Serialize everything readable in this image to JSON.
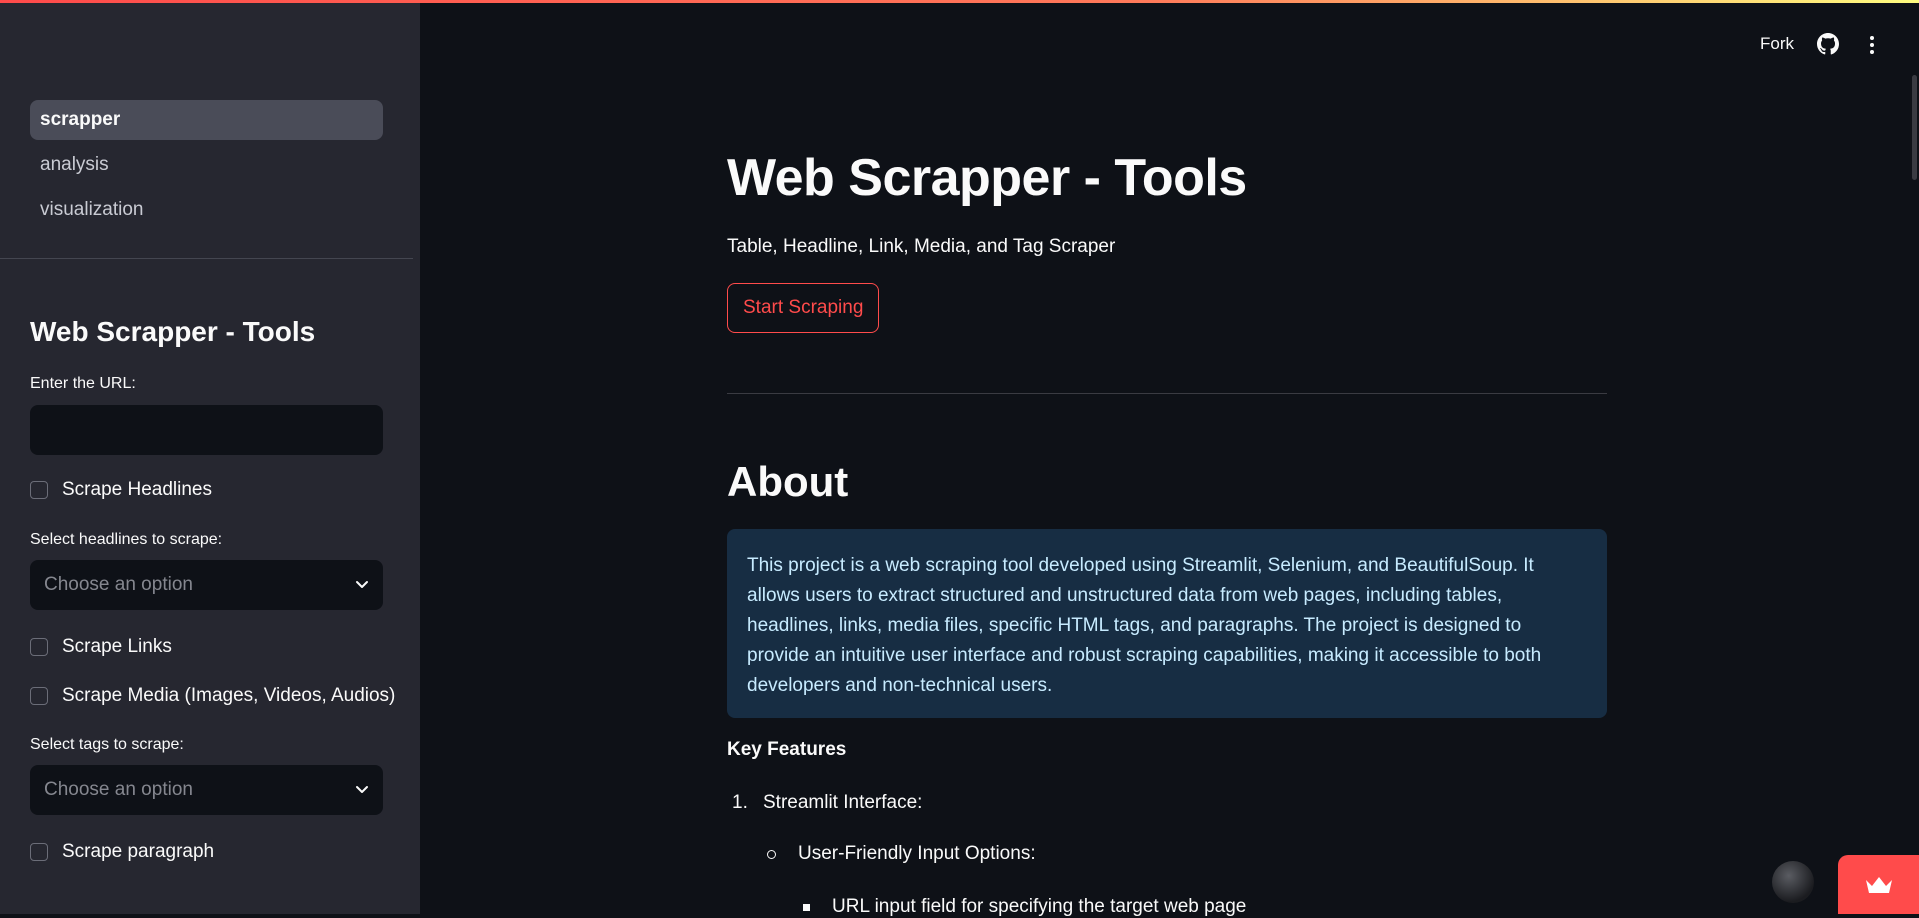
{
  "sidebar": {
    "nav": [
      {
        "label": "scrapper"
      },
      {
        "label": "analysis"
      },
      {
        "label": "visualization"
      }
    ],
    "title": "Web Scrapper - Tools",
    "url_label": "Enter the URL:",
    "url_value": "",
    "scrape_headlines": "Scrape Headlines",
    "headlines_select_label": "Select headlines to scrape:",
    "headlines_placeholder": "Choose an option",
    "scrape_links": "Scrape Links",
    "scrape_media": "Scrape Media (Images, Videos, Audios)",
    "tags_select_label": "Select tags to scrape:",
    "tags_placeholder": "Choose an option",
    "scrape_paragraph": "Scrape paragraph"
  },
  "header": {
    "fork": "Fork",
    "github_icon": "github-icon",
    "menu_icon": "kebab-menu-icon"
  },
  "main": {
    "title": "Web Scrapper - Tools",
    "subtitle": "Table, Headline, Link, Media, and Tag Scraper",
    "start_button": "Start Scraping",
    "about_heading": "About",
    "about_text": "This project is a web scraping tool developed using Streamlit, Selenium, and BeautifulSoup. It allows users to extract structured and unstructured data from web pages, including tables, headlines, links, media files, specific HTML tags, and paragraphs. The project is designed to provide an intuitive user interface and robust scraping capabilities, making it accessible to both developers and non-technical users.",
    "key_features": "Key Features",
    "list1_num": "1.",
    "list1_item": "Streamlit Interface:",
    "list2_item": "User-Friendly Input Options:",
    "list3_item": "URL input field for specifying the target web page"
  },
  "colors": {
    "accent": "#ff4b4b",
    "background": "#0e1117",
    "sidebar": "#262730",
    "info_bg": "#172d43",
    "info_text": "#c7ebff"
  }
}
